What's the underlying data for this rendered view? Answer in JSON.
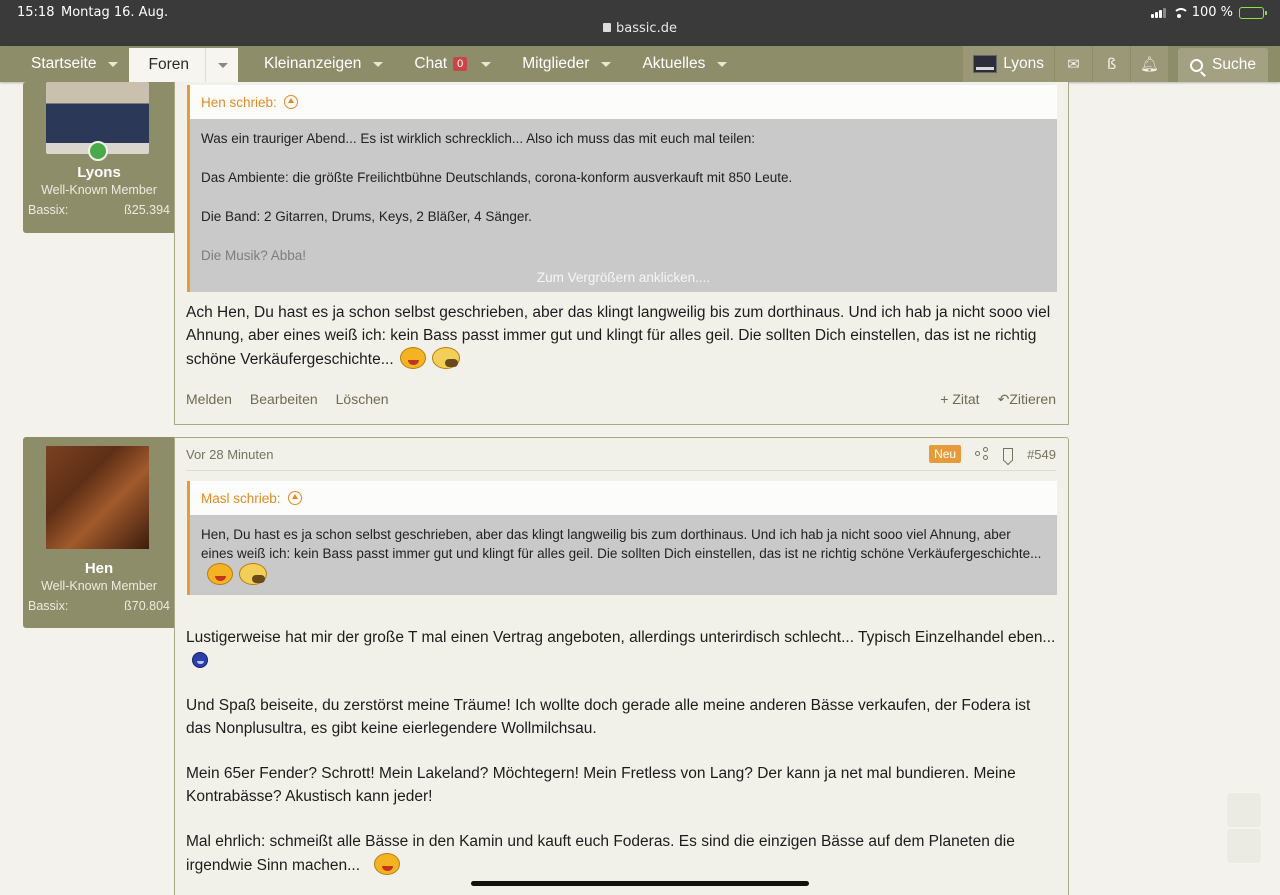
{
  "status_bar": {
    "time": "15:18",
    "date": "Montag 16. Aug.",
    "url": "bassic.de",
    "battery": "100 %"
  },
  "nav": {
    "tabs": [
      {
        "label": "Startseite"
      },
      {
        "label": "Foren"
      },
      {
        "label": "Kleinanzeigen"
      },
      {
        "label": "Chat",
        "badge": "0"
      },
      {
        "label": "Mitglieder"
      },
      {
        "label": "Aktuelles"
      }
    ],
    "user": "Lyons",
    "bass_icon": "ß",
    "search": "Suche"
  },
  "post1": {
    "user": {
      "name": "Lyons",
      "title": "Well-Known Member",
      "stat_label": "Bassix:",
      "stat_value": "ß25.394"
    },
    "quote": {
      "author": "Hen schrieb:",
      "lines": [
        "Was ein trauriger Abend... Es ist wirklich schrecklich... Also ich muss das mit euch mal teilen:",
        "Das Ambiente: die größte Freilichtbühne Deutschlands, corona-konform ausverkauft mit 850 Leute.",
        "Die Band: 2 Gitarren, Drums, Keys, 2 Bläßer, 4 Sänger.",
        "Die Musik? Abba!"
      ],
      "expand": "Zum Vergrößern anklicken...."
    },
    "text": "Ach Hen, Du hast es ja schon selbst geschrieben, aber das klingt langweilig bis zum dorthinaus. Und ich hab ja nicht sooo viel Ahnung, aber eines weiß ich: kein Bass passt immer gut und klingt für alles geil. Die sollten Dich einstellen, das ist ne richtig schöne Verkäufergeschichte...",
    "actions": {
      "report": "Melden",
      "edit": "Bearbeiten",
      "delete": "Löschen",
      "quote_add": "+ Zitat",
      "reply": "Zitieren"
    }
  },
  "post2": {
    "user": {
      "name": "Hen",
      "title": "Well-Known Member",
      "stat_label": "Bassix:",
      "stat_value": "ß70.804"
    },
    "time": "Vor 28 Minuten",
    "new_badge": "Neu",
    "number": "#549",
    "quote": {
      "author": "Masl schrieb:",
      "text": "Hen, Du hast es ja schon selbst geschrieben, aber das klingt langweilig bis zum dorthinaus. Und ich hab ja nicht sooo viel Ahnung, aber eines weiß ich: kein Bass passt immer gut und klingt für alles geil. Die sollten Dich einstellen, das ist ne richtig schöne Verkäufergeschichte..."
    },
    "paragraphs": [
      "Lustigerweise hat mir der große T mal einen Vertrag angeboten, allerdings unterirdisch schlecht... Typisch Einzelhandel eben...",
      "Und Spaß beiseite, du zerstörst meine Träume! Ich wollte doch gerade alle meine anderen Bässe verkaufen, der Fodera ist das Nonplusultra, es gibt keine eierlegendere Wollmilchsau.",
      "Mein 65er Fender? Schrott! Mein Lakeland? Möchtegern! Mein Fretless von Lang? Der kann ja net mal bundieren. Meine Kontrabässe? Akustisch kann jeder!",
      "Mal ehrlich: schmeißt alle Bässe in den Kamin und kauft euch Foderas. Es sind die einzigen Bässe auf dem Planeten die irgendwie Sinn machen..."
    ]
  }
}
